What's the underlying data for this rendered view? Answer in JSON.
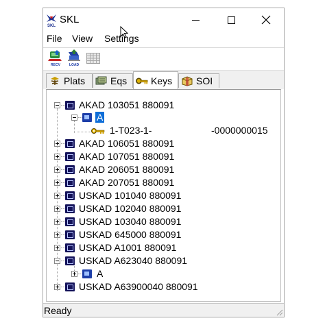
{
  "window": {
    "title": "SKL",
    "controls": [
      "minimize",
      "maximize",
      "close"
    ]
  },
  "menu": {
    "file": "File",
    "view": "View",
    "settings": "Settings"
  },
  "toolbar": {
    "recv_label": "RECV",
    "load_label": "LOAD"
  },
  "tabs": [
    {
      "label": "Plats",
      "icon": "plant-icon"
    },
    {
      "label": "Eqs",
      "icon": "equipment-icon"
    },
    {
      "label": "Keys",
      "icon": "key-icon",
      "active": true
    },
    {
      "label": "SOI",
      "icon": "box-icon"
    }
  ],
  "tree": {
    "nodes": [
      {
        "label": "AKAD 103051 880091",
        "expanded": true
      },
      {
        "label": "A",
        "expanded": true,
        "selected": true
      },
      {
        "label": "1-T023-1-",
        "value": "-0000000015"
      },
      {
        "label": "AKAD 106051 880091",
        "expanded": false
      },
      {
        "label": "AKAD 107051 880091",
        "expanded": false
      },
      {
        "label": "AKAD 206051 880091",
        "expanded": false
      },
      {
        "label": "AKAD 207051 880091",
        "expanded": false
      },
      {
        "label": "USKAD 101040 880091",
        "expanded": false
      },
      {
        "label": "USKAD 102040 880091",
        "expanded": false
      },
      {
        "label": "USKAD 103040 880091",
        "expanded": false
      },
      {
        "label": "USKAD 645000 880091",
        "expanded": false
      },
      {
        "label": "USKAD A1001 880091",
        "expanded": false
      },
      {
        "label": "USKAD A623040 880091",
        "expanded": true
      },
      {
        "label": "A",
        "expanded": false
      },
      {
        "label": "USKAD A63900040 880091",
        "expanded": false
      }
    ]
  },
  "status": {
    "text": "Ready"
  },
  "colors": {
    "selection": "#0f6ed8",
    "tree_icon": "#14135a",
    "key_gold": "#d4a400"
  }
}
